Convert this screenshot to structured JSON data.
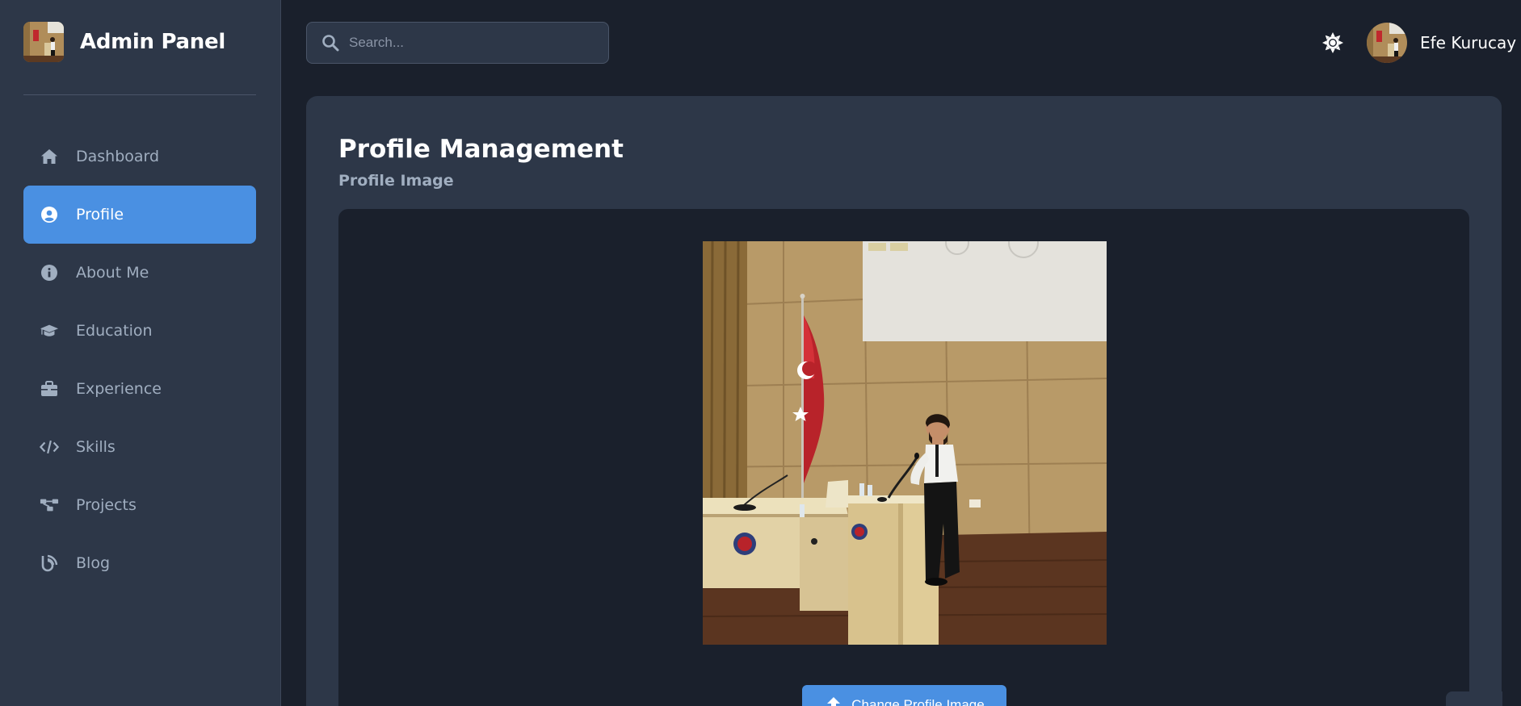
{
  "sidebar": {
    "brand_title": "Admin Panel",
    "items": [
      {
        "label": "Dashboard",
        "icon": "home-icon",
        "active": false
      },
      {
        "label": "Profile",
        "icon": "user-circle-icon",
        "active": true
      },
      {
        "label": "About Me",
        "icon": "info-circle-icon",
        "active": false
      },
      {
        "label": "Education",
        "icon": "graduation-cap-icon",
        "active": false
      },
      {
        "label": "Experience",
        "icon": "briefcase-icon",
        "active": false
      },
      {
        "label": "Skills",
        "icon": "code-icon",
        "active": false
      },
      {
        "label": "Projects",
        "icon": "project-diagram-icon",
        "active": false
      },
      {
        "label": "Blog",
        "icon": "blog-icon",
        "active": false
      }
    ]
  },
  "header": {
    "search_placeholder": "Search...",
    "theme_icon": "sun-icon",
    "user_name": "Efe Kurucay"
  },
  "main": {
    "title": "Profile Management",
    "section_title": "Profile Image",
    "change_button_label": "Change Profile Image",
    "upload_icon": "upload-icon"
  },
  "colors": {
    "accent": "#4a90e2",
    "sidebar_bg": "#2d3748",
    "page_bg": "#1a202c",
    "muted_text": "#a0aec0"
  }
}
